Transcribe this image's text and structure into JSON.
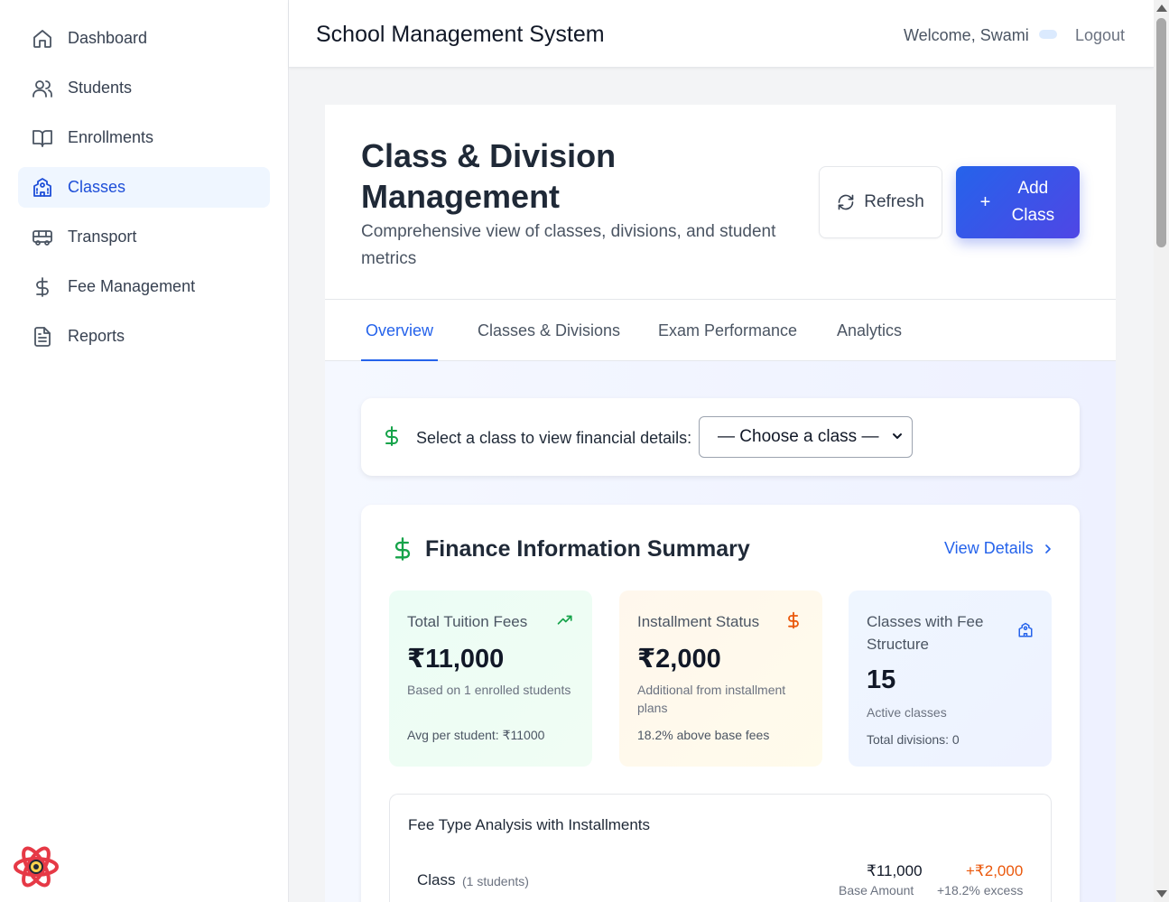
{
  "sidebar": {
    "items": [
      {
        "label": "Dashboard",
        "icon": "home-icon"
      },
      {
        "label": "Students",
        "icon": "users-icon"
      },
      {
        "label": "Enrollments",
        "icon": "book-open-icon"
      },
      {
        "label": "Classes",
        "icon": "school-icon"
      },
      {
        "label": "Transport",
        "icon": "bus-icon"
      },
      {
        "label": "Fee Management",
        "icon": "dollar-icon"
      },
      {
        "label": "Reports",
        "icon": "file-text-icon"
      }
    ],
    "active_index": 3
  },
  "header": {
    "title": "School Management System",
    "welcome": "Welcome, Swami",
    "logout": "Logout"
  },
  "page": {
    "title": "Class & Division Management",
    "subtitle": "Comprehensive view of classes, divisions, and student metrics",
    "refresh_label": "Refresh",
    "add_label": "Add Class"
  },
  "tabs": [
    {
      "label": "Overview",
      "active": true
    },
    {
      "label": "Classes & Divisions",
      "active": false
    },
    {
      "label": "Exam Performance",
      "active": false
    },
    {
      "label": "Analytics",
      "active": false
    }
  ],
  "class_select": {
    "label": "Select a class to view financial details:",
    "selected": "— Choose a class —"
  },
  "finance": {
    "title": "Finance Information Summary",
    "view_details": "View Details",
    "cards": {
      "tuition": {
        "label": "Total Tuition Fees",
        "value": "₹11,000",
        "note": "Based on 1 enrolled students",
        "foot": "Avg per student: ₹11000",
        "icon": "trending-up-icon"
      },
      "installment": {
        "label": "Installment Status",
        "value": "₹2,000",
        "note": "Additional from installment plans",
        "foot": "18.2% above base fees",
        "icon": "dollar-icon"
      },
      "classes": {
        "label": "Classes with Fee Structure",
        "value": "15",
        "note": "Active classes",
        "foot": "Total divisions: 0",
        "icon": "school-icon"
      }
    },
    "fee_analysis": {
      "title": "Fee Type Analysis with Installments",
      "rows": [
        {
          "name": "Class",
          "count": "(1 students)",
          "base_amount": "₹11,000",
          "base_label": "Base Amount",
          "excess": "+₹2,000",
          "excess_label": "+18.2% excess"
        }
      ]
    }
  },
  "colors": {
    "primary": "#2563eb",
    "success": "#16a34a",
    "warning": "#ea580c",
    "active_bg": "#eff6ff"
  }
}
